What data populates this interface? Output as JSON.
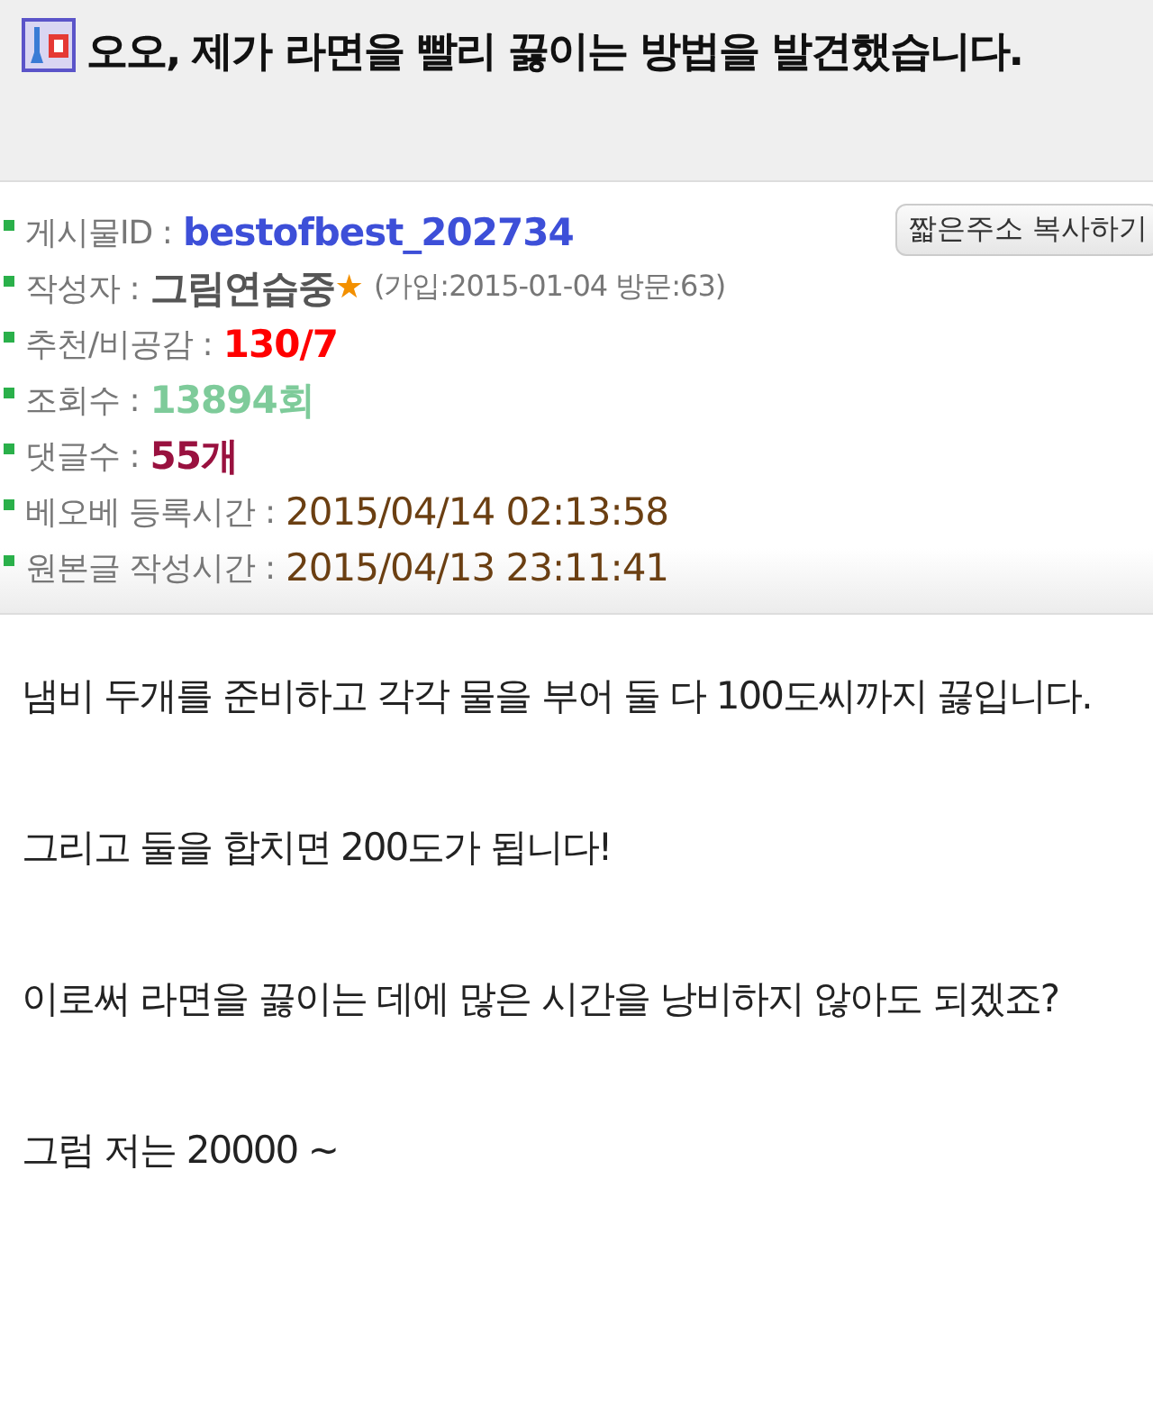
{
  "title": "오오, 제가 라면을 빨리 끓이는 방법을 발견했습니다.",
  "meta": [
    {
      "label": "게시물ID :",
      "value": "bestofbest_202734",
      "color": "#3d4fd8",
      "kind": "bold"
    },
    {
      "label": "작성자 :",
      "value": "그림연습중",
      "color": "#555555",
      "kind": "bold",
      "star": "★",
      "extra": "(가입:2015-01-04 방문:63)"
    },
    {
      "label": "추천/비공감 :",
      "value": "130/7",
      "color": "#ff0000",
      "kind": "bold"
    },
    {
      "label": "조회수 :",
      "value": "13894회",
      "color": "#7ecb9a",
      "kind": "bold"
    },
    {
      "label": "댓글수 :",
      "value": "55개",
      "color": "#99113f",
      "kind": "bold"
    },
    {
      "label": "베오베 등록시간 :",
      "value": "2015/04/14 02:13:58",
      "color": "#6b3f12",
      "kind": "plain"
    },
    {
      "label": "원본글 작성시간 :",
      "value": "2015/04/13 23:11:41",
      "color": "#6b3f12",
      "kind": "plain"
    }
  ],
  "copy_button": "짧은주소 복사하기",
  "body": [
    "냄비 두개를 준비하고 각각 물을 부어 둘 다 100도씨까지 끓입니다.",
    "그리고 둘을 합치면 200도가 됩니다!",
    "이로써 라면을 끓이는 데에 많은 시간을 낭비하지 않아도 되겠죠?",
    "그럼 저는 20000 ~"
  ]
}
